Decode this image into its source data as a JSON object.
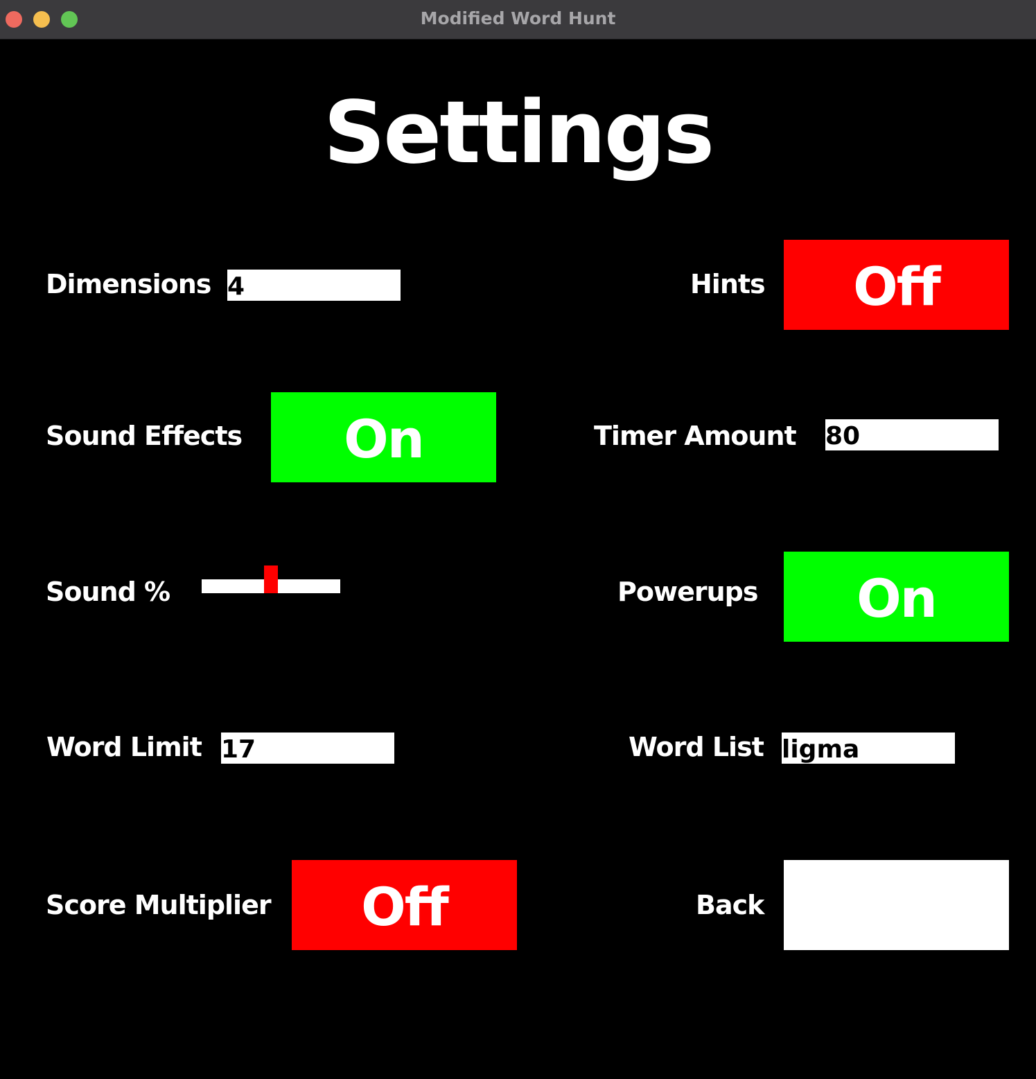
{
  "window": {
    "title": "Modified Word Hunt"
  },
  "page": {
    "heading": "Settings"
  },
  "colors": {
    "on": "#00ff00",
    "off": "#ff0000",
    "background": "#000000",
    "field": "#ffffff",
    "slider_handle": "#ff0000"
  },
  "settings": {
    "dimensions": {
      "label": "Dimensions",
      "value": "4"
    },
    "hints": {
      "label": "Hints",
      "state": "Off"
    },
    "sound_effects": {
      "label": "Sound Effects",
      "state": "On"
    },
    "timer_amount": {
      "label": "Timer Amount",
      "value": "80"
    },
    "sound_percent": {
      "label": "Sound %",
      "level": 0.5
    },
    "powerups": {
      "label": "Powerups",
      "state": "On"
    },
    "word_limit": {
      "label": "Word Limit",
      "value": "17"
    },
    "word_list": {
      "label": "Word List",
      "value": "ligma"
    },
    "score_multiplier": {
      "label": "Score Multiplier",
      "state": "Off"
    },
    "back": {
      "label": "Back",
      "button_text": ""
    }
  }
}
